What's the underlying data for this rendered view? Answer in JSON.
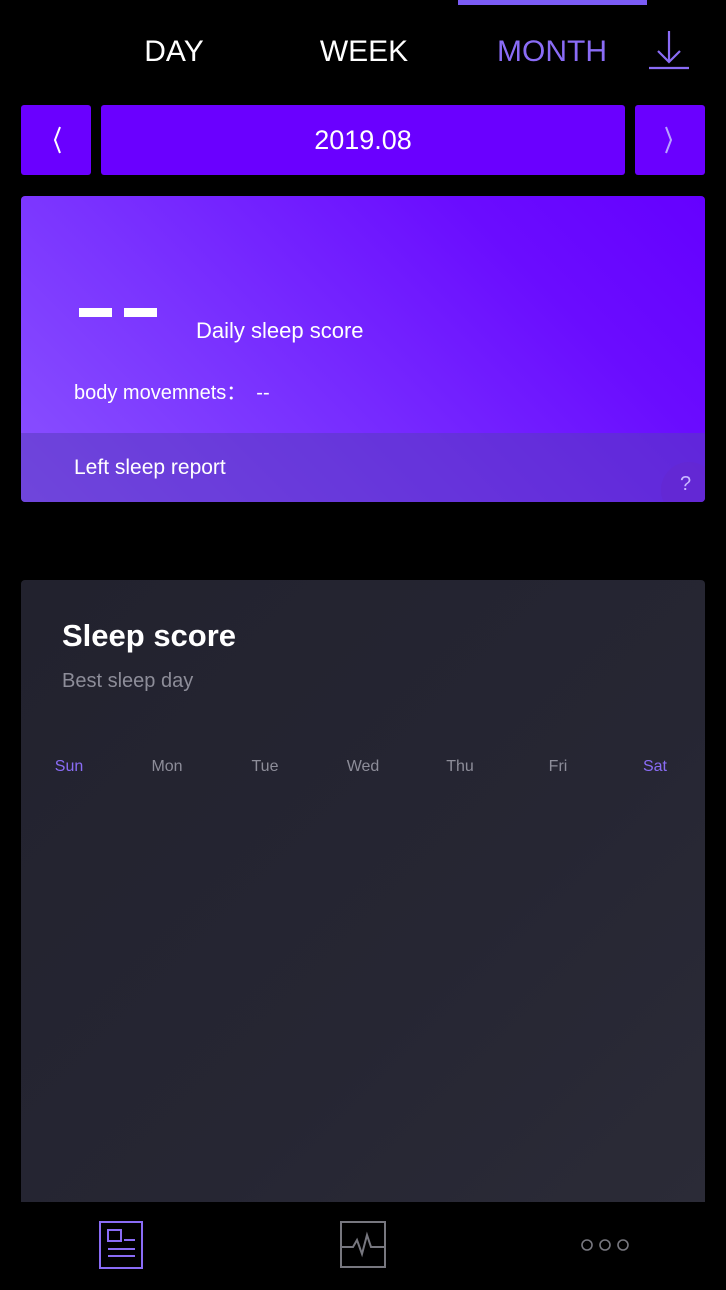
{
  "tabs": [
    {
      "label": "DAY"
    },
    {
      "label": "WEEK"
    },
    {
      "label": "MONTH"
    }
  ],
  "date_nav": {
    "current": "2019.08"
  },
  "score_card": {
    "score_value": "--",
    "score_label": "Daily sleep score",
    "movements_label": "body movemnets：",
    "movements_value": "--",
    "report_label": "Left sleep report",
    "help_symbol": "?"
  },
  "sleep_panel": {
    "title": "Sleep score",
    "subtitle": "Best sleep day",
    "weekdays": [
      "Sun",
      "Mon",
      "Tue",
      "Wed",
      "Thu",
      "Fri",
      "Sat"
    ]
  },
  "colors": {
    "accent": "#8a6cf6",
    "primary": "#6a00ff",
    "background": "#000000",
    "panel": "#262633"
  },
  "icons": {
    "download": "download-icon",
    "prev": "chevron-left-icon",
    "next": "chevron-right-icon",
    "report": "report-icon",
    "pulse": "heartbeat-icon",
    "more": "more-dots-icon"
  }
}
